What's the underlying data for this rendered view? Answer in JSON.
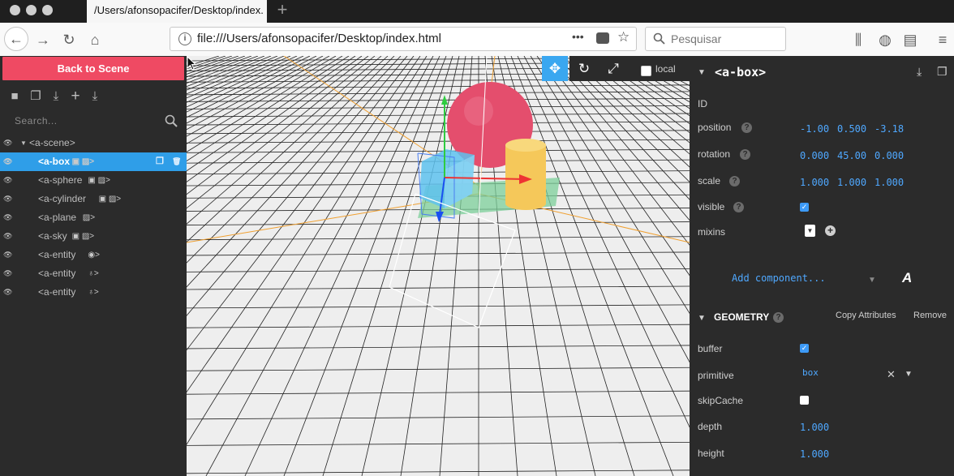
{
  "browser": {
    "tab_title": "/Users/afonsopacifer/Desktop/index.html",
    "url": "file:///Users/afonsopacifer/Desktop/index.html",
    "search_placeholder": "Pesquisar",
    "page_actions_label": "•••"
  },
  "left_panel": {
    "back_button_label": "Back to Scene",
    "toolbar_icons": [
      "camera-icon",
      "copy-icon",
      "download-icon",
      "add-icon",
      "export-icon"
    ],
    "search_placeholder": "Search...",
    "outline": [
      {
        "label": "<a-scene>",
        "icons": "",
        "selected": false,
        "indent": 1
      },
      {
        "label": "<a-box",
        "icons": "▣ ▨>",
        "selected": true,
        "indent": 2
      },
      {
        "label": "<a-sphere",
        "icons": "▣ ▨>",
        "selected": false,
        "indent": 2
      },
      {
        "label": "<a-cylinder",
        "icons": "▣ ▨>",
        "selected": false,
        "indent": 2
      },
      {
        "label": "<a-plane",
        "icons": "▨>",
        "selected": false,
        "indent": 2
      },
      {
        "label": "<a-sky",
        "icons": "▣ ▨>",
        "selected": false,
        "indent": 2
      },
      {
        "label": "<a-entity",
        "icons": "◉>",
        "selected": false,
        "indent": 2
      },
      {
        "label": "<a-entity",
        "icons": "♁>",
        "selected": false,
        "indent": 2
      },
      {
        "label": "<a-entity",
        "icons": "♁>",
        "selected": false,
        "indent": 2
      }
    ]
  },
  "viewport": {
    "local_label": "local"
  },
  "right_panel": {
    "entity_title": "<a-box>",
    "id_label": "ID",
    "position": {
      "label": "position",
      "x": "-1.00",
      "y": "0.500",
      "z": "-3.18"
    },
    "rotation": {
      "label": "rotation",
      "x": "0.000",
      "y": "45.00",
      "z": "0.000"
    },
    "scale": {
      "label": "scale",
      "x": "1.000",
      "y": "1.000",
      "z": "1.000"
    },
    "visible": {
      "label": "visible",
      "checked": true
    },
    "mixins": {
      "label": "mixins"
    },
    "add_component_label": "Add component...",
    "geometry": {
      "title": "GEOMETRY",
      "copy_label": "Copy Attributes",
      "remove_label": "Remove",
      "buffer": {
        "label": "buffer",
        "checked": true
      },
      "primitive": {
        "label": "primitive",
        "value": "box"
      },
      "skipCache": {
        "label": "skipCache",
        "checked": false
      },
      "depth": {
        "label": "depth",
        "value": "1.000"
      },
      "height": {
        "label": "height",
        "value": "1.000"
      }
    }
  },
  "colors": {
    "accent_red": "#ef4a63",
    "selection_blue": "#2f9ee8",
    "value_blue": "#4fa8ff",
    "panel_bg": "#2b2b2b"
  }
}
